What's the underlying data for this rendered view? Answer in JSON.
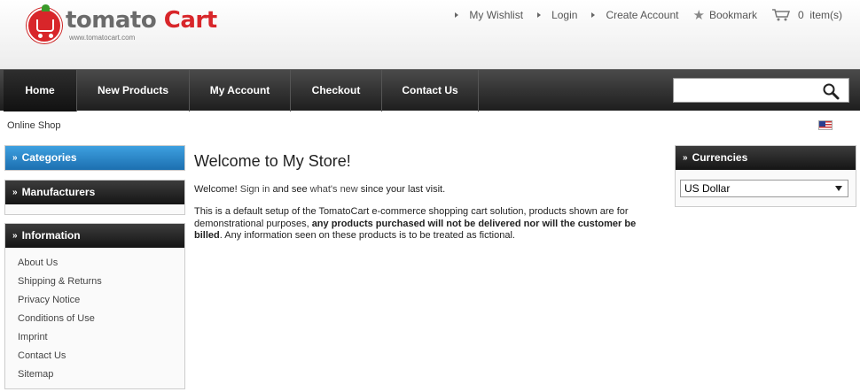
{
  "logo": {
    "brand_main": "tomato",
    "brand_accent": "Cart",
    "url": "www.tomatocart.com"
  },
  "toplinks": {
    "wishlist": "My Wishlist",
    "login": "Login",
    "create_account": "Create Account",
    "bookmark": "Bookmark",
    "cart": "0  item(s)"
  },
  "nav": {
    "items": [
      {
        "label": "Home"
      },
      {
        "label": "New Products"
      },
      {
        "label": "My Account"
      },
      {
        "label": "Checkout"
      },
      {
        "label": "Contact Us"
      }
    ]
  },
  "search": {
    "value": "",
    "placeholder": ""
  },
  "breadcrumb": "Online Shop",
  "sidebar": {
    "categories_title": "Categories",
    "manufacturers_title": "Manufacturers",
    "information_title": "Information",
    "information_items": [
      {
        "label": "About Us"
      },
      {
        "label": "Shipping & Returns"
      },
      {
        "label": "Privacy Notice"
      },
      {
        "label": "Conditions of Use"
      },
      {
        "label": "Imprint"
      },
      {
        "label": "Contact Us"
      },
      {
        "label": "Sitemap"
      }
    ]
  },
  "main": {
    "title": "Welcome to My Store!",
    "welcome_prefix": "Welcome! ",
    "sign_in": "Sign in",
    "and_see": " and see ",
    "whats_new": "what's new",
    "since": " since your last visit.",
    "para_1": "This is a default setup of the TomatoCart e-commerce shopping cart solution, products shown are for demonstrational purposes, ",
    "para_bold": "any products purchased will not be delivered nor will the customer be billed",
    "para_2": ". Any information seen on these products is to be treated as fictional."
  },
  "currencies": {
    "title": "Currencies",
    "selected": "US Dollar"
  },
  "colors": {
    "brand_red": "#d8262a",
    "nav_dark": "#1e1e1e",
    "categories_blue": "#1c6fb0"
  }
}
